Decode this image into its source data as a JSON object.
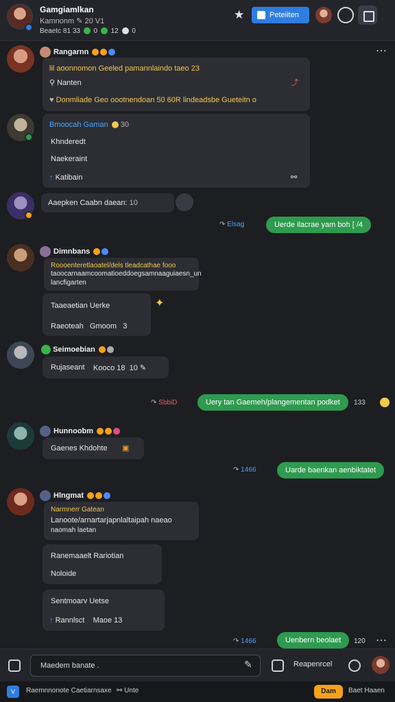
{
  "header": {
    "title": "Gamgiamlkan",
    "subtitle": "Kamnonm ✎ 20 V1",
    "meta": "Beaetc 81 33",
    "meta_counts": [
      "0",
      "12",
      "0"
    ],
    "primary_button": "Peteiiten"
  },
  "messages": [
    {
      "sender": "Rangarnn",
      "lines": [
        "lil aoonnomon Geeled pamannlaindo taeo 23",
        "Nanten",
        "Donmliade Geo oootnendoan 50 60R lindeadsbe Gueteitn o"
      ]
    },
    {
      "sender": "Bmoocah Gaman",
      "meta": "30",
      "lines": [
        "Khnderedt",
        "Naekeraint",
        "Katibain"
      ]
    },
    {
      "sender": "",
      "lines": [
        "Aaepken Caabn daean:"
      ],
      "meta": "10"
    },
    {
      "outgoing": true,
      "meta": "Elsag",
      "text": "Uerde ilacrae yam boh",
      "status": "[ /4"
    },
    {
      "sender": "Dimnbans",
      "lines": [
        "Roooenteretlaoatel/dels tleadcathae fooo",
        "taoocarnaamcoomatioeddoegsamnaaguiaesn_un",
        "lancfigarten"
      ],
      "cards": [
        "Taaeaetian Uerke",
        "Raeoteah",
        "Gmoom",
        "3"
      ]
    },
    {
      "sender": "Seimoebian",
      "lines": [
        "Rujaseant",
        "Kooco 18",
        "10"
      ]
    },
    {
      "outgoing": true,
      "meta": "SbbiD",
      "text": "Uery tan Gaemeh/plangementan podket",
      "status": "133"
    },
    {
      "sender": "Hunnoobm",
      "lines": [
        "Gaenes Khdohte"
      ]
    },
    {
      "outgoing": true,
      "meta": "1466",
      "text": "Uarde baenkan aenbiktatet"
    },
    {
      "sender": "Hlngmat",
      "lines": [
        "Narmnerr Gatean",
        "Lanoote/arnartarjapnlaltaipah naeao",
        "naomah laetan"
      ],
      "cards": [
        "Ranemaaelt Rariotian",
        "Noloide",
        "Sentmoarv Uetse",
        "Rannlsct",
        "Maoe 13"
      ]
    },
    {
      "outgoing": true,
      "meta": "1466",
      "text": "Uenbern beolaet",
      "status": "120"
    }
  ],
  "composer": {
    "placeholder": "Maedem banate .",
    "send_label": "Reapenrcel"
  },
  "statusbar": {
    "left": "Raemnnonote Caetiarnsaxe",
    "mid": "Unte",
    "badge": "Dam",
    "right": "Baet Haaen"
  }
}
